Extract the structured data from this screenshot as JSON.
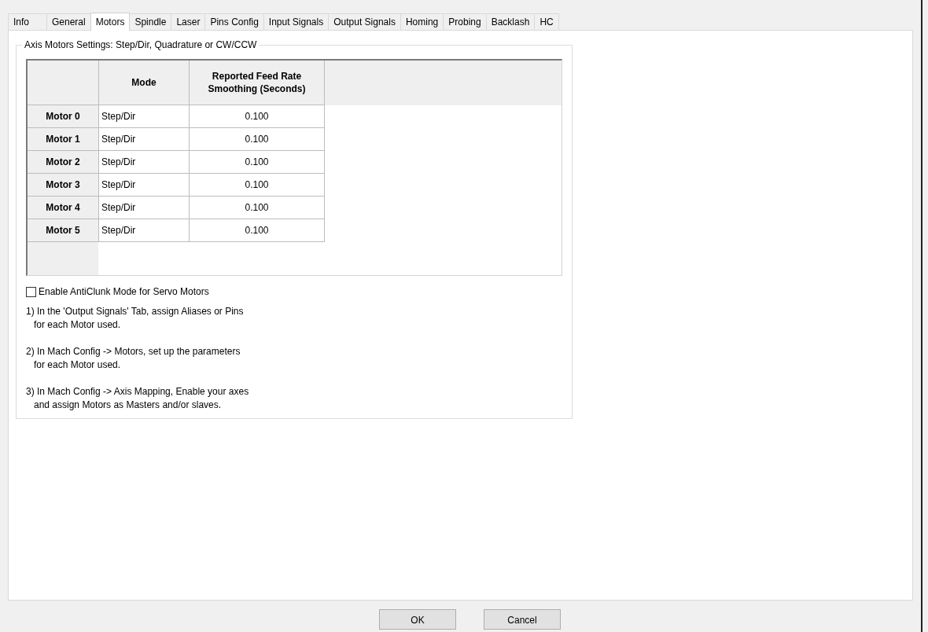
{
  "tabs": [
    {
      "label": "Info",
      "selected": false
    },
    {
      "label": "General",
      "selected": false
    },
    {
      "label": "Motors",
      "selected": true
    },
    {
      "label": "Spindle",
      "selected": false
    },
    {
      "label": "Laser",
      "selected": false
    },
    {
      "label": "Pins Config",
      "selected": false
    },
    {
      "label": "Input Signals",
      "selected": false
    },
    {
      "label": "Output Signals",
      "selected": false
    },
    {
      "label": "Homing",
      "selected": false
    },
    {
      "label": "Probing",
      "selected": false
    },
    {
      "label": "Backlash",
      "selected": false
    },
    {
      "label": "HC",
      "selected": false
    }
  ],
  "group": {
    "title": "Axis Motors Settings: Step/Dir, Quadrature or CW/CCW",
    "table": {
      "columns": [
        "Mode",
        "Reported Feed Rate Smoothing (Seconds)"
      ],
      "rows": [
        {
          "header": "Motor 0",
          "mode": "Step/Dir",
          "smoothing": "0.100"
        },
        {
          "header": "Motor 1",
          "mode": "Step/Dir",
          "smoothing": "0.100"
        },
        {
          "header": "Motor 2",
          "mode": "Step/Dir",
          "smoothing": "0.100"
        },
        {
          "header": "Motor 3",
          "mode": "Step/Dir",
          "smoothing": "0.100"
        },
        {
          "header": "Motor 4",
          "mode": "Step/Dir",
          "smoothing": "0.100"
        },
        {
          "header": "Motor 5",
          "mode": "Step/Dir",
          "smoothing": "0.100"
        }
      ]
    },
    "checkbox": {
      "label": "Enable AntiClunk Mode for Servo Motors",
      "checked": false
    },
    "instructions": [
      {
        "lines": [
          "1) In the 'Output Signals' Tab, assign Aliases or Pins",
          "for each Motor used."
        ]
      },
      {
        "lines": [
          "2) In Mach Config -> Motors, set up the parameters",
          "for each Motor used."
        ]
      },
      {
        "lines": [
          "3) In Mach Config -> Axis Mapping, Enable your axes",
          "and assign Motors as Masters and/or slaves."
        ]
      }
    ]
  },
  "buttons": [
    "OK",
    "Cancel"
  ]
}
